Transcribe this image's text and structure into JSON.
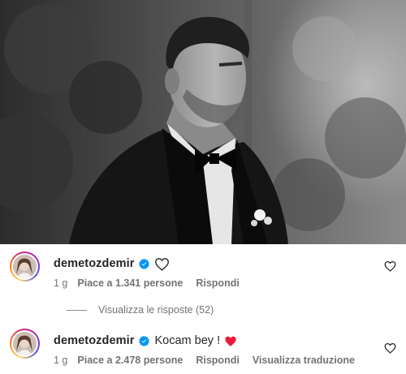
{
  "comments": [
    {
      "username": "demetozdemir",
      "text": "",
      "time": "1 g",
      "likes": "Piace a 1.341 persone",
      "reply_label": "Rispondi",
      "icons": [
        "verified-badge-icon",
        "outline-heart-icon",
        "like-heart-icon"
      ]
    },
    {
      "username": "demetozdemir",
      "text": "Kocam bey !",
      "time": "1 g",
      "likes": "Piace a 2.478 persone",
      "reply_label": "Rispondi",
      "translate_label": "Visualizza traduzione",
      "icons": [
        "verified-badge-icon",
        "red-heart-icon",
        "like-heart-icon"
      ]
    }
  ],
  "view_replies": "Visualizza le risposte (52)",
  "colors": {
    "verified": "#0095f6",
    "heart_red": "#ed1b3a",
    "text": "#262626",
    "secondary": "#737373"
  }
}
